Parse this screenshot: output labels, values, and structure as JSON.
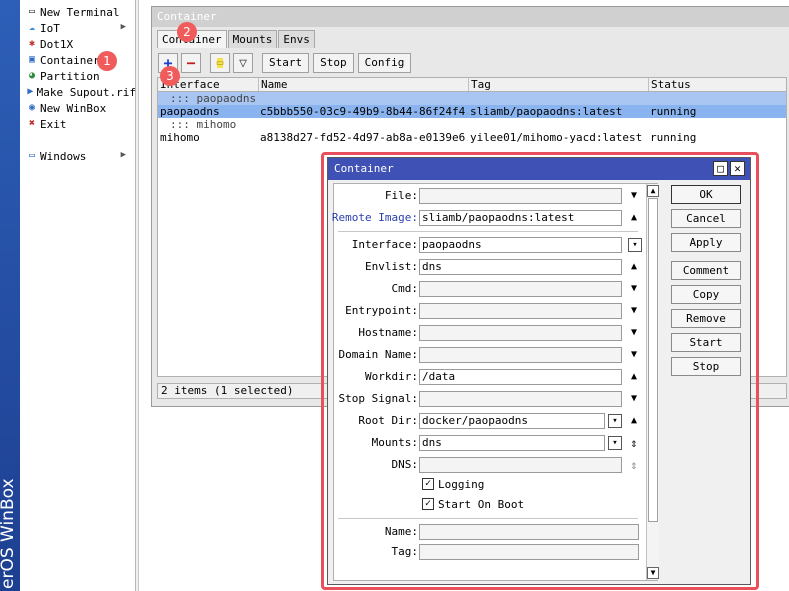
{
  "brand": {
    "text": "erOS WinBox"
  },
  "menu": {
    "items": [
      {
        "label": "New Terminal",
        "icon": "terminal-icon",
        "glyph": "▭",
        "color": "#333333",
        "submenu": false
      },
      {
        "label": "IoT",
        "icon": "iot-icon",
        "glyph": "☁",
        "color": "#3a8bd8",
        "submenu": true
      },
      {
        "label": "Dot1X",
        "icon": "dot1x-icon",
        "glyph": "✱",
        "color": "#c03030",
        "submenu": false
      },
      {
        "label": "Container",
        "icon": "container-icon",
        "glyph": "▣",
        "color": "#2d6bc4",
        "submenu": false
      },
      {
        "label": "Partition",
        "icon": "partition-icon",
        "glyph": "◕",
        "color": "#2e8b3e",
        "submenu": false
      },
      {
        "label": "Make Supout.rif",
        "icon": "supout-icon",
        "glyph": "▶",
        "color": "#2d6bc4",
        "submenu": false
      },
      {
        "label": "New WinBox",
        "icon": "winbox-icon",
        "glyph": "◉",
        "color": "#2d6bc4",
        "submenu": false
      },
      {
        "label": "Exit",
        "icon": "exit-icon",
        "glyph": "✖",
        "color": "#c03030",
        "submenu": false
      },
      {
        "label": "Windows",
        "icon": "windows-icon",
        "glyph": "▭",
        "color": "#2d6bc4",
        "submenu": true
      }
    ]
  },
  "badges": {
    "one": "1",
    "two": "2",
    "three": "3"
  },
  "list_window": {
    "title": "Container",
    "tabs": [
      "Container",
      "Mounts",
      "Envs"
    ],
    "toolbar": {
      "add": "+",
      "remove": "−",
      "comment": "▭",
      "filter": "▽",
      "start": "Start",
      "stop": "Stop",
      "config": "Config"
    },
    "columns": [
      "Interface",
      "Name",
      "Tag",
      "Status"
    ],
    "rows": [
      {
        "type": "comment",
        "text": "::: paopaodns"
      },
      {
        "type": "data",
        "interface": "paopaodns",
        "name": "c5bbb550-03c9-49b9-8b44-86f24f4...",
        "tag": "sliamb/paopaodns:latest",
        "status": "running"
      },
      {
        "type": "comment",
        "text": "::: mihomo"
      },
      {
        "type": "data",
        "interface": "mihomo",
        "name": "a8138d27-fd52-4d97-ab8a-e0139e6...",
        "tag": "yilee01/mihomo-yacd:latest",
        "status": "running"
      }
    ],
    "status": "2 items (1 selected)"
  },
  "dialog": {
    "title": "Container",
    "fields": {
      "file": {
        "label": "File:",
        "value": ""
      },
      "remote_image": {
        "label": "Remote Image:",
        "value": "sliamb/paopaodns:latest"
      },
      "interface": {
        "label": "Interface:",
        "value": "paopaodns"
      },
      "envlist": {
        "label": "Envlist:",
        "value": "dns"
      },
      "cmd": {
        "label": "Cmd:",
        "value": ""
      },
      "entrypoint": {
        "label": "Entrypoint:",
        "value": ""
      },
      "hostname": {
        "label": "Hostname:",
        "value": ""
      },
      "domain_name": {
        "label": "Domain Name:",
        "value": ""
      },
      "workdir": {
        "label": "Workdir:",
        "value": "/data"
      },
      "stop_signal": {
        "label": "Stop Signal:",
        "value": ""
      },
      "root_dir": {
        "label": "Root Dir:",
        "value": "docker/paopaodns"
      },
      "mounts": {
        "label": "Mounts:",
        "value": "dns"
      },
      "dns": {
        "label": "DNS:",
        "value": ""
      },
      "name": {
        "label": "Name:",
        "value": ""
      },
      "tag": {
        "label": "Tag:",
        "value": ""
      }
    },
    "checkboxes": {
      "logging": {
        "label": "Logging",
        "checked": true
      },
      "start_on_boot": {
        "label": "Start On Boot",
        "checked": true
      }
    },
    "buttons": [
      "OK",
      "Cancel",
      "Apply",
      "Comment",
      "Copy",
      "Remove",
      "Start",
      "Stop"
    ],
    "controls": {
      "restore": "□",
      "close": "✕"
    },
    "icons": {
      "down": "▼",
      "up": "▲",
      "dropdown": "▾",
      "updown": "⇕"
    }
  },
  "colors": {
    "highlight": "#e8505b",
    "badge": "#f05c5c",
    "selection": "#8ab4f0",
    "dialog_title": "#3f51b5"
  }
}
